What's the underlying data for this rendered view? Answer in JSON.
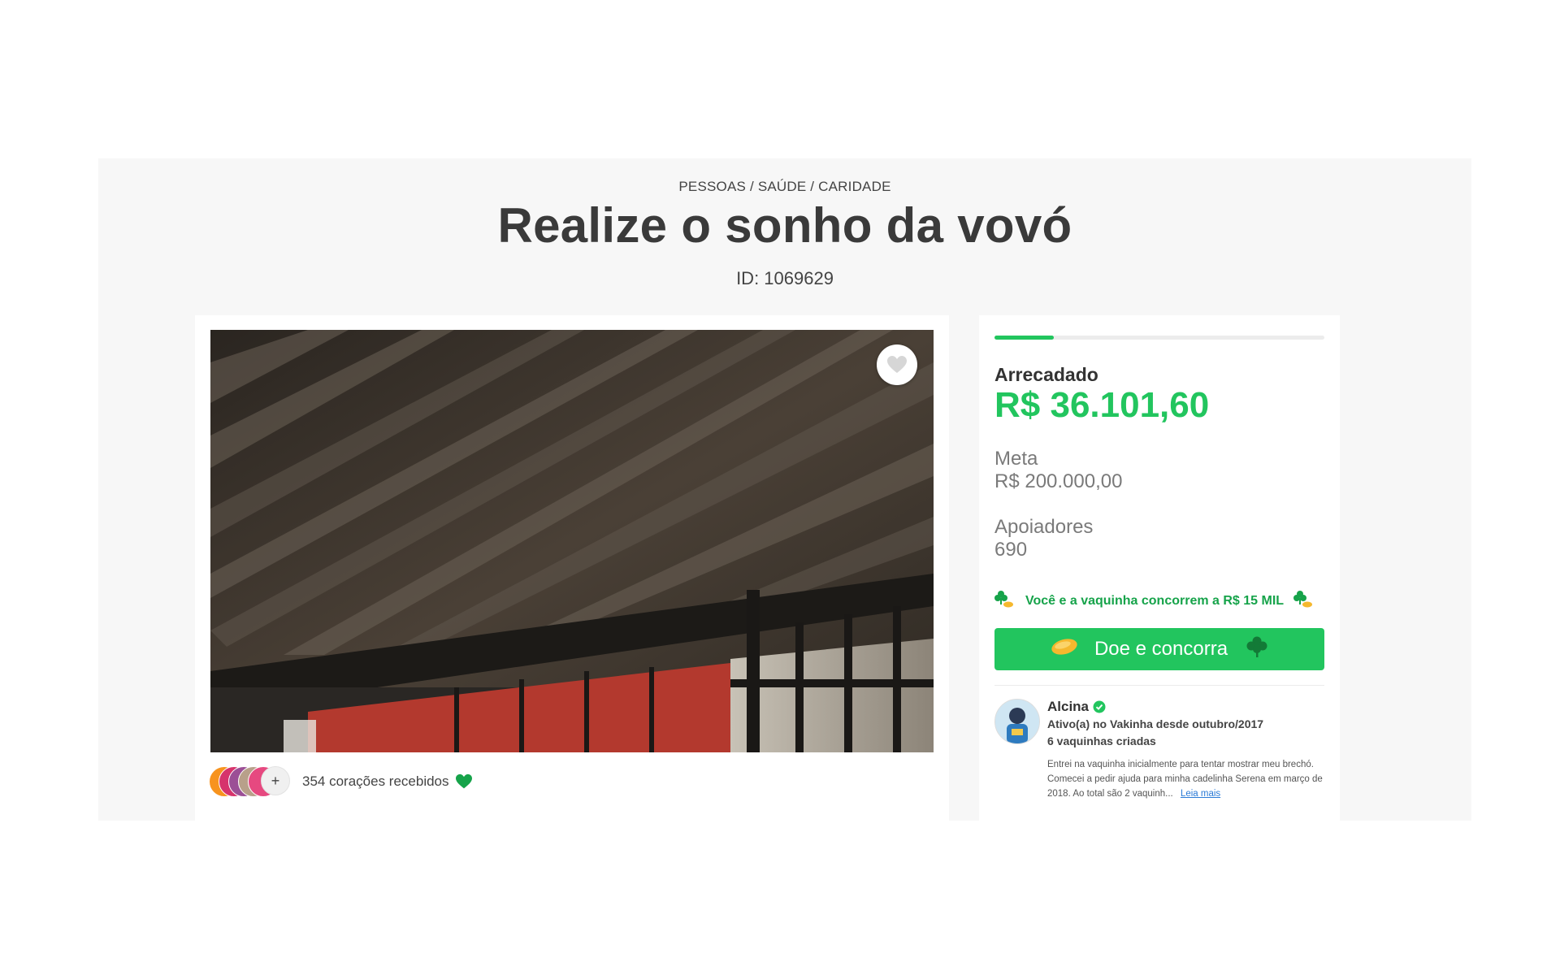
{
  "campaign": {
    "category": "PESSOAS / SAÚDE / CARIDADE",
    "title": "Realize o sonho da vovó",
    "id_text": "ID: 1069629"
  },
  "media": {
    "favorite_icon": "heart-outline-icon",
    "hearts_count_text": "354 corações recebidos",
    "more_label": "+",
    "supporter_avatar_colors": [
      "#f7931e",
      "#d6336c",
      "#9b4f96",
      "#b8a08a",
      "#e64980"
    ]
  },
  "stats": {
    "progress_fraction": 0.18,
    "raised_label": "Arrecadado",
    "raised_value": "R$ 36.101,60",
    "goal_label": "Meta",
    "goal_value": "R$ 200.000,00",
    "supporters_label": "Apoiadores",
    "supporters_value": "690"
  },
  "promo": {
    "text": "Você e a vaquinha concorrem a R$ 15 MIL",
    "icon": "clover-coin-icon"
  },
  "donate": {
    "label": "Doe e concorra",
    "left_icon": "coin-icon",
    "right_icon": "clover-icon"
  },
  "organizer": {
    "name": "Alcina",
    "active_since": "Ativo(a) no Vakinha desde outubro/2017",
    "campaigns_created": "6 vaquinhas criadas",
    "bio": "Entrei na vaquinha inicialmente para tentar mostrar meu brechó. Comecei a pedir ajuda para minha cadelinha Serena em março de 2018. Ao total são 2 vaquinh...",
    "read_more": "Leia mais"
  },
  "colors": {
    "accent_green": "#22c55e",
    "dark_green": "#16a34a",
    "panel_bg": "#f7f7f7"
  }
}
